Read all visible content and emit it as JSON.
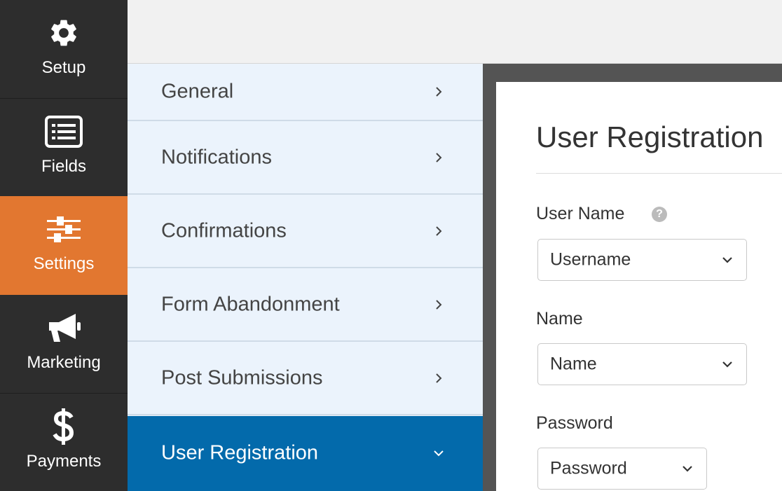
{
  "sidebar": {
    "items": [
      {
        "label": "Setup",
        "icon": "gear-icon"
      },
      {
        "label": "Fields",
        "icon": "fields-list-icon"
      },
      {
        "label": "Settings",
        "icon": "sliders-icon"
      },
      {
        "label": "Marketing",
        "icon": "megaphone-icon"
      },
      {
        "label": "Payments",
        "icon": "dollar-icon"
      }
    ],
    "active_index": 2
  },
  "settings_menu": {
    "items": [
      {
        "label": "General"
      },
      {
        "label": "Notifications"
      },
      {
        "label": "Confirmations"
      },
      {
        "label": "Form Abandonment"
      },
      {
        "label": "Post Submissions"
      },
      {
        "label": "User Registration"
      }
    ],
    "active_index": 5
  },
  "panel": {
    "title": "User Registration",
    "fields": [
      {
        "label": "User Name",
        "value": "Username",
        "has_help": true
      },
      {
        "label": "Name",
        "value": "Name",
        "has_help": false
      },
      {
        "label": "Password",
        "value": "Password",
        "has_help": false
      }
    ]
  },
  "colors": {
    "sidebar_bg": "#2d2d2d",
    "active_orange": "#e27730",
    "submenu_bg": "#ebf3fc",
    "active_blue": "#036aab",
    "frame_gray": "#545454"
  }
}
